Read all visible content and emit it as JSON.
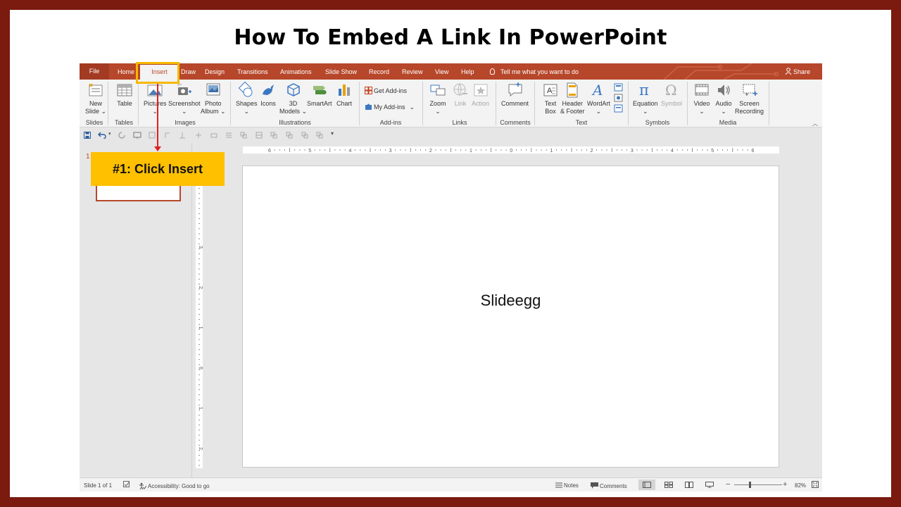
{
  "page": {
    "title": "How To Embed A Link In PowerPoint"
  },
  "menubar": {
    "tabs": [
      {
        "label": "File"
      },
      {
        "label": "Home"
      },
      {
        "label": "Insert",
        "active": true
      },
      {
        "label": "Draw"
      },
      {
        "label": "Design"
      },
      {
        "label": "Transitions"
      },
      {
        "label": "Animations"
      },
      {
        "label": "Slide Show"
      },
      {
        "label": "Record"
      },
      {
        "label": "Review"
      },
      {
        "label": "View"
      },
      {
        "label": "Help"
      }
    ],
    "tell_me": "Tell me what you want to do",
    "share": "Share"
  },
  "ribbon": {
    "new_slide": [
      "New",
      "Slide ⌄"
    ],
    "table": "Table",
    "pictures": "Pictures",
    "screenshot": "Screenshot",
    "photo_album": [
      "Photo",
      "Album ⌄"
    ],
    "shapes": "Shapes",
    "icons": "Icons",
    "models_3d": [
      "3D",
      "Models ⌄"
    ],
    "smartart": "SmartArt",
    "chart": "Chart",
    "get_addins": "Get Add-ins",
    "my_addins": "My Add-ins",
    "zoom": "Zoom",
    "link": "Link",
    "action": "Action",
    "comment": "Comment",
    "text_box": [
      "Text",
      "Box"
    ],
    "header_footer": [
      "Header",
      "& Footer"
    ],
    "wordart": "WordArt",
    "equation": "Equation",
    "symbol": "Symbol",
    "video": "Video",
    "audio": "Audio",
    "screen_recording": [
      "Screen",
      "Recording"
    ],
    "groups": {
      "slides": "Slides",
      "tables": "Tables",
      "images": "Images",
      "illustrations": "Illustrations",
      "addins": "Add-ins",
      "links": "Links",
      "comments": "Comments",
      "text": "Text",
      "symbols": "Symbols",
      "media": "Media"
    }
  },
  "rulers": {
    "horizontal_labels": [
      "6",
      "5",
      "4",
      "3",
      "2",
      "1",
      "0",
      "1",
      "2",
      "3",
      "4",
      "5",
      "6"
    ],
    "vertical_labels": [
      "3",
      "2",
      "1",
      "0",
      "1",
      "2",
      "3"
    ]
  },
  "thumbnails": {
    "slide_number": "1"
  },
  "slide": {
    "text": "Slideegg"
  },
  "statusbar": {
    "slide_of": "Slide 1 of 1",
    "accessibility": "Accessibility: Good to go",
    "notes": "Notes",
    "comments": "Comments",
    "zoom_level": "82%"
  },
  "callout": {
    "text": "#1: Click Insert"
  },
  "colors": {
    "accent": "#b7472a",
    "highlight": "#f6b800",
    "callout": "#ffc000",
    "frame": "#7b1a0f"
  }
}
